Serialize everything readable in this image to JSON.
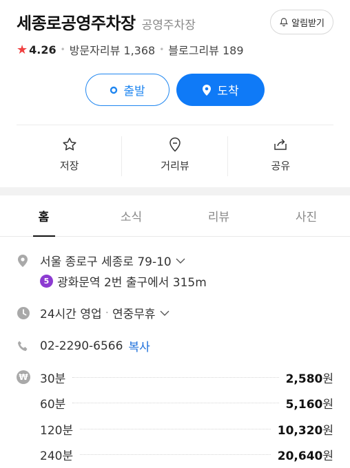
{
  "header": {
    "title": "세종로공영주차장",
    "category": "공영주차장",
    "alarm_label": "알림받기"
  },
  "rating": {
    "score": "4.26",
    "visitor_reviews_label": "방문자리뷰",
    "visitor_reviews_count": "1,368",
    "blog_reviews_label": "블로그리뷰",
    "blog_reviews_count": "189"
  },
  "route": {
    "depart_label": "출발",
    "arrive_label": "도착"
  },
  "actions": [
    {
      "label": "저장",
      "icon": "star-icon"
    },
    {
      "label": "거리뷰",
      "icon": "street-view-icon"
    },
    {
      "label": "공유",
      "icon": "share-icon"
    }
  ],
  "tabs": [
    {
      "label": "홈",
      "active": true
    },
    {
      "label": "소식",
      "active": false
    },
    {
      "label": "리뷰",
      "active": false
    },
    {
      "label": "사진",
      "active": false
    }
  ],
  "info": {
    "address": "서울 종로구 세종로 79-10",
    "subway_line": "5",
    "subway_line_color": "#8c3bd1",
    "subway_directions": "광화문역 2번 출구에서 315m",
    "hours": "24시간 영업",
    "holiday": "연중무휴",
    "phone": "02-2290-6566",
    "copy_label": "복사"
  },
  "fees": {
    "currency_unit": "원",
    "items": [
      {
        "duration": "30분",
        "price": "2,580"
      },
      {
        "duration": "60분",
        "price": "5,160"
      },
      {
        "duration": "120분",
        "price": "10,320"
      },
      {
        "duration": "240분",
        "price": "20,640"
      }
    ]
  },
  "colors": {
    "accent": "#0f7af7",
    "star": "#f04040"
  }
}
